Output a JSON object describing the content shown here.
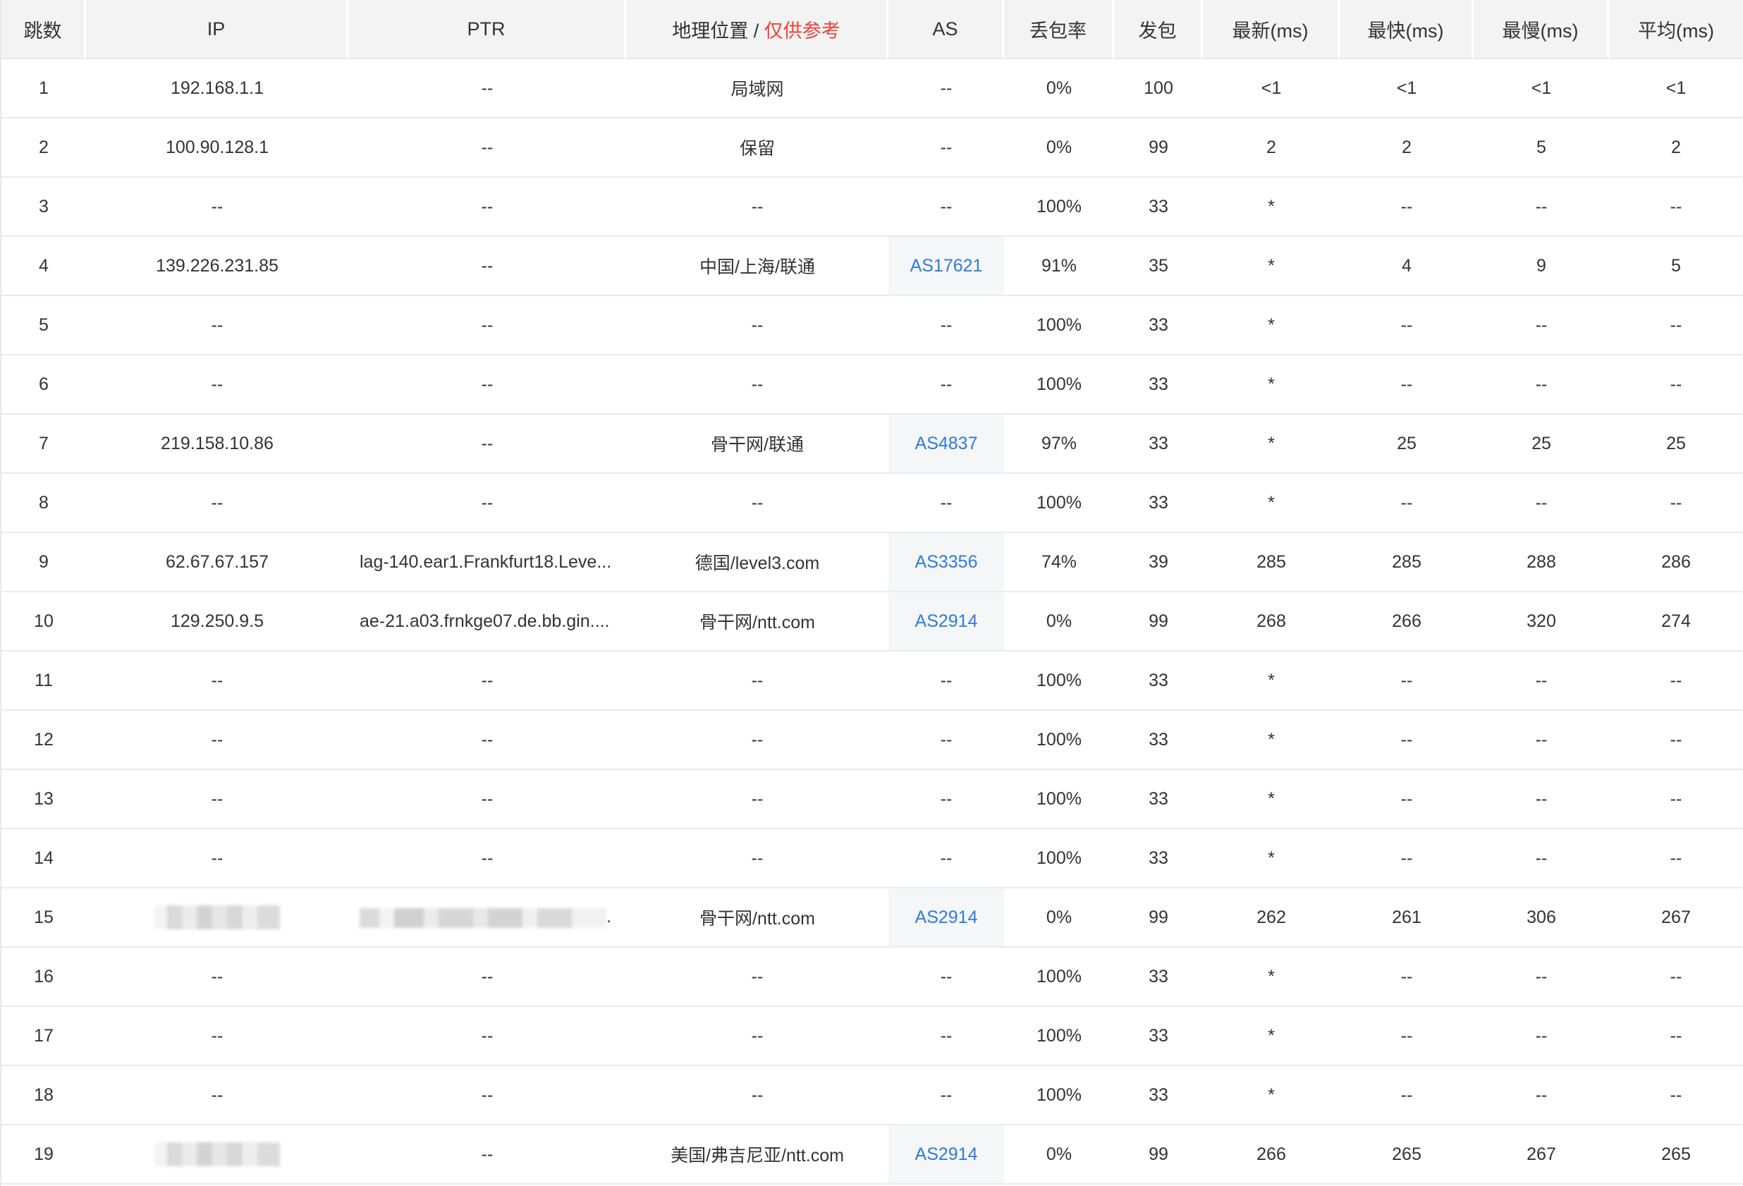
{
  "headers": {
    "hop": "跳数",
    "ip": "IP",
    "ptr": "PTR",
    "geo": "地理位置 /",
    "geo_warn": "仅供参考",
    "as": "AS",
    "loss": "丢包率",
    "sent": "发包",
    "last": "最新(ms)",
    "best": "最快(ms)",
    "worst": "最慢(ms)",
    "avg": "平均(ms)"
  },
  "rows": [
    {
      "hop": "1",
      "ip": "192.168.1.1",
      "ptr": "--",
      "geo": "局域网",
      "as": "--",
      "loss": "0%",
      "sent": "100",
      "last": "<1",
      "best": "<1",
      "worst": "<1",
      "avg": "<1"
    },
    {
      "hop": "2",
      "ip": "100.90.128.1",
      "ptr": "--",
      "geo": "保留",
      "as": "--",
      "loss": "0%",
      "sent": "99",
      "last": "2",
      "best": "2",
      "worst": "5",
      "avg": "2"
    },
    {
      "hop": "3",
      "ip": "--",
      "ptr": "--",
      "geo": "--",
      "as": "--",
      "loss": "100%",
      "sent": "33",
      "last": "*",
      "best": "--",
      "worst": "--",
      "avg": "--"
    },
    {
      "hop": "4",
      "ip": "139.226.231.85",
      "ptr": "--",
      "geo": "中国/上海/联通",
      "as": "AS17621",
      "loss": "91%",
      "sent": "35",
      "last": "*",
      "best": "4",
      "worst": "9",
      "avg": "5"
    },
    {
      "hop": "5",
      "ip": "--",
      "ptr": "--",
      "geo": "--",
      "as": "--",
      "loss": "100%",
      "sent": "33",
      "last": "*",
      "best": "--",
      "worst": "--",
      "avg": "--"
    },
    {
      "hop": "6",
      "ip": "--",
      "ptr": "--",
      "geo": "--",
      "as": "--",
      "loss": "100%",
      "sent": "33",
      "last": "*",
      "best": "--",
      "worst": "--",
      "avg": "--"
    },
    {
      "hop": "7",
      "ip": "219.158.10.86",
      "ptr": "--",
      "geo": "骨干网/联通",
      "as": "AS4837",
      "loss": "97%",
      "sent": "33",
      "last": "*",
      "best": "25",
      "worst": "25",
      "avg": "25"
    },
    {
      "hop": "8",
      "ip": "--",
      "ptr": "--",
      "geo": "--",
      "as": "--",
      "loss": "100%",
      "sent": "33",
      "last": "*",
      "best": "--",
      "worst": "--",
      "avg": "--"
    },
    {
      "hop": "9",
      "ip": "62.67.67.157",
      "ptr": "lag-140.ear1.Frankfurt18.Leve...",
      "geo": "德国/level3.com",
      "as": "AS3356",
      "loss": "74%",
      "sent": "39",
      "last": "285",
      "best": "285",
      "worst": "288",
      "avg": "286"
    },
    {
      "hop": "10",
      "ip": "129.250.9.5",
      "ptr": "ae-21.a03.frnkge07.de.bb.gin....",
      "geo": "骨干网/ntt.com",
      "as": "AS2914",
      "loss": "0%",
      "sent": "99",
      "last": "268",
      "best": "266",
      "worst": "320",
      "avg": "274"
    },
    {
      "hop": "11",
      "ip": "--",
      "ptr": "--",
      "geo": "--",
      "as": "--",
      "loss": "100%",
      "sent": "33",
      "last": "*",
      "best": "--",
      "worst": "--",
      "avg": "--"
    },
    {
      "hop": "12",
      "ip": "--",
      "ptr": "--",
      "geo": "--",
      "as": "--",
      "loss": "100%",
      "sent": "33",
      "last": "*",
      "best": "--",
      "worst": "--",
      "avg": "--"
    },
    {
      "hop": "13",
      "ip": "--",
      "ptr": "--",
      "geo": "--",
      "as": "--",
      "loss": "100%",
      "sent": "33",
      "last": "*",
      "best": "--",
      "worst": "--",
      "avg": "--"
    },
    {
      "hop": "14",
      "ip": "--",
      "ptr": "--",
      "geo": "--",
      "as": "--",
      "loss": "100%",
      "sent": "33",
      "last": "*",
      "best": "--",
      "worst": "--",
      "avg": "--"
    },
    {
      "hop": "15",
      "ip": "",
      "ip_redacted": true,
      "ptr": "",
      "ptr_redacted": true,
      "geo": "骨干网/ntt.com",
      "as": "AS2914",
      "loss": "0%",
      "sent": "99",
      "last": "262",
      "best": "261",
      "worst": "306",
      "avg": "267"
    },
    {
      "hop": "16",
      "ip": "--",
      "ptr": "--",
      "geo": "--",
      "as": "--",
      "loss": "100%",
      "sent": "33",
      "last": "*",
      "best": "--",
      "worst": "--",
      "avg": "--"
    },
    {
      "hop": "17",
      "ip": "--",
      "ptr": "--",
      "geo": "--",
      "as": "--",
      "loss": "100%",
      "sent": "33",
      "last": "*",
      "best": "--",
      "worst": "--",
      "avg": "--"
    },
    {
      "hop": "18",
      "ip": "--",
      "ptr": "--",
      "geo": "--",
      "as": "--",
      "loss": "100%",
      "sent": "33",
      "last": "*",
      "best": "--",
      "worst": "--",
      "avg": "--"
    },
    {
      "hop": "19",
      "ip": "",
      "ip_redacted": true,
      "ptr": "--",
      "geo": "美国/弗吉尼亚/ntt.com",
      "as": "AS2914",
      "loss": "0%",
      "sent": "99",
      "last": "266",
      "best": "265",
      "worst": "267",
      "avg": "265"
    }
  ],
  "colors": {
    "header_bg": "#f3f3f3",
    "link": "#2f7bdf",
    "warning": "#f0413a",
    "as_cell_bg": "#f4f6f8"
  }
}
